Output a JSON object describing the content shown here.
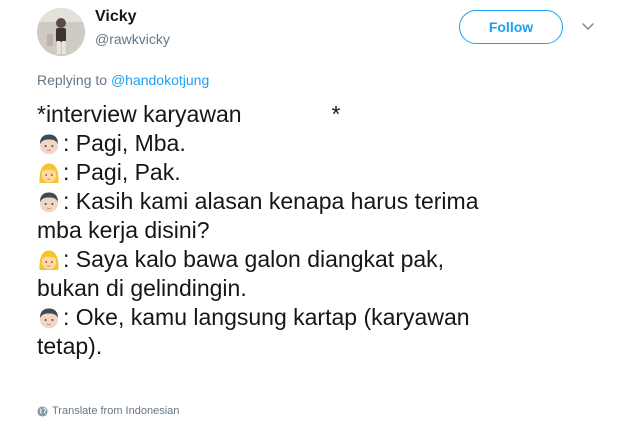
{
  "tweet": {
    "display_name": "Vicky",
    "handle": "@rawkvicky",
    "follow_label": "Follow",
    "replying_prefix": "Replying to ",
    "replying_to": "@handokotjung",
    "lines": {
      "l1": "*interview karyawan",
      "l1_end": "*",
      "l2": ": Pagi, Mba.",
      "l3": ": Pagi, Pak.",
      "l4": ": Kasih kami alasan kenapa harus terima",
      "l5": "mba kerja disini?",
      "l6": ": Saya kalo bawa galon diangkat pak,",
      "l7": "bukan di gelindingin.",
      "l8": ": Oke, kamu langsung kartap (karyawan",
      "l9": "tetap)."
    },
    "translate_label": "Translate from Indonesian"
  },
  "icons": {
    "man": "man-face-icon",
    "woman": "woman-face-icon",
    "menu": "chevron-down-icon",
    "globe": "globe-icon"
  },
  "colors": {
    "accent": "#1da1f2",
    "secondary_text": "#657786",
    "primary_text": "#14171a"
  }
}
